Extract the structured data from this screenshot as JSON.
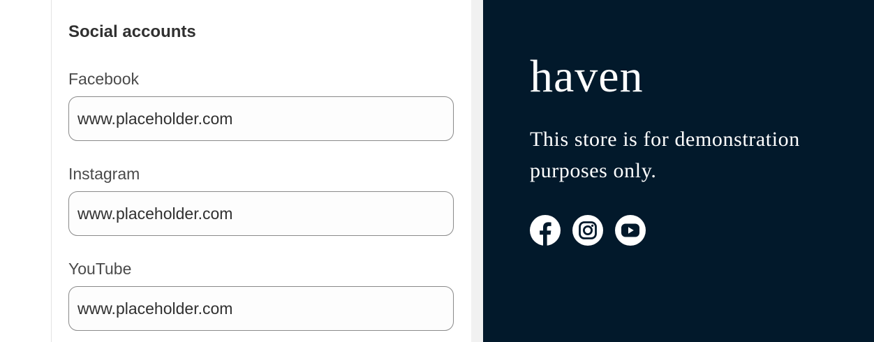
{
  "social_section": {
    "title": "Social accounts",
    "fields": [
      {
        "label": "Facebook",
        "value": "www.placeholder.com"
      },
      {
        "label": "Instagram",
        "value": "www.placeholder.com"
      },
      {
        "label": "YouTube",
        "value": "www.placeholder.com"
      }
    ]
  },
  "preview": {
    "brand": "haven",
    "tagline": "This store is for demonstration purposes only.",
    "background_color": "#02192b",
    "icons": [
      "facebook-icon",
      "instagram-icon",
      "youtube-icon"
    ]
  }
}
